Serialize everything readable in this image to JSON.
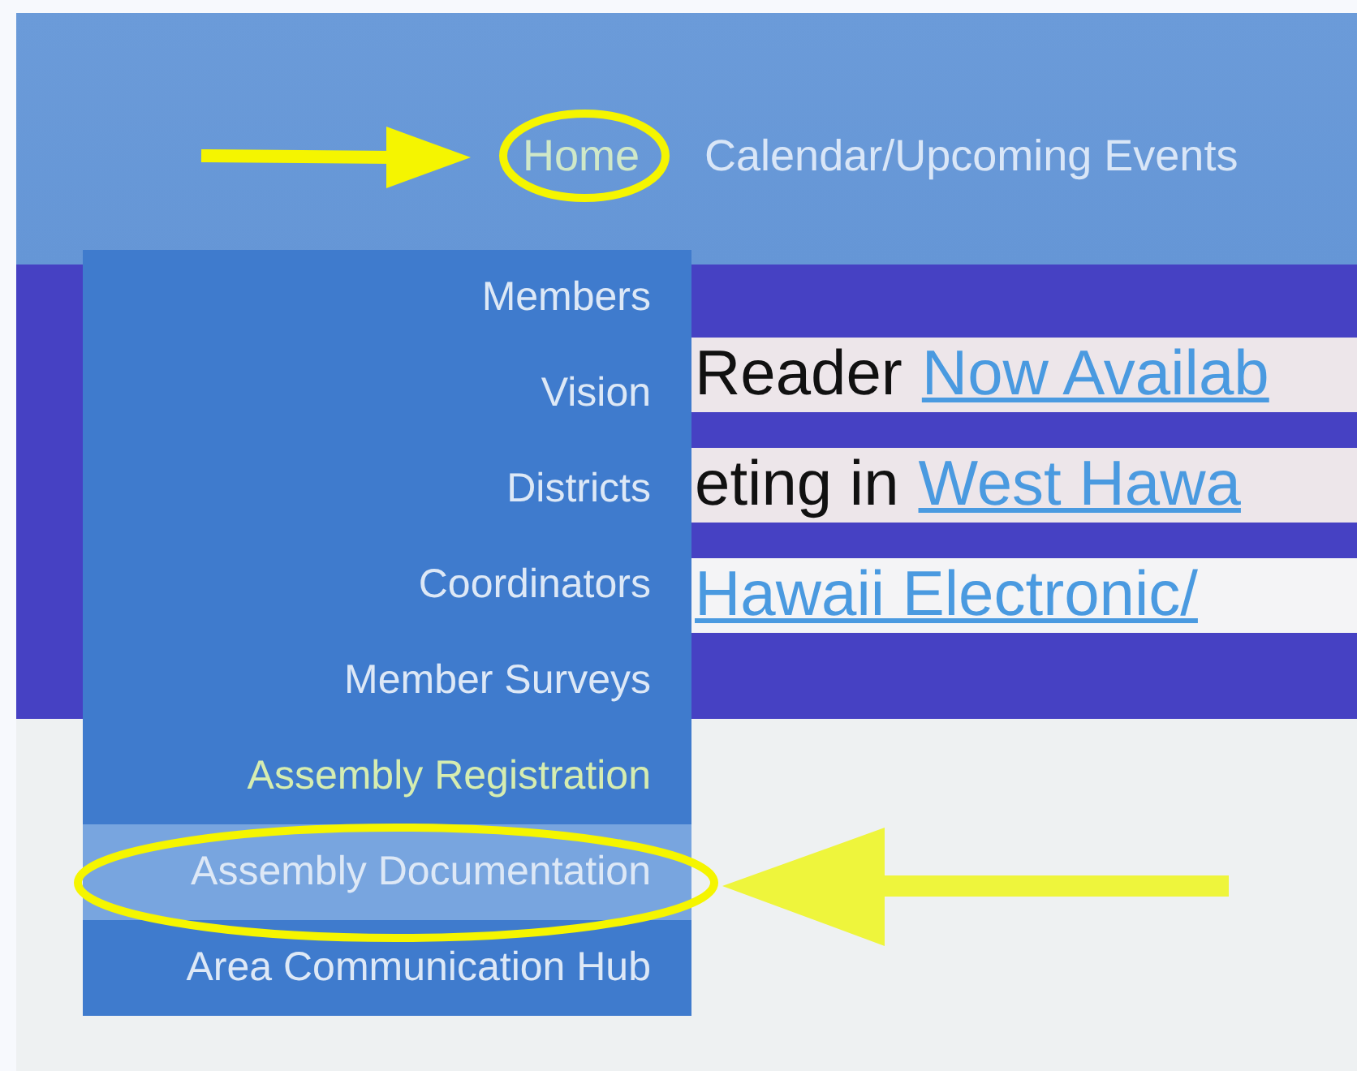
{
  "nav": [
    {
      "label": "Home",
      "selected": true
    },
    {
      "label": "Calendar/Upcoming Events",
      "selected": false
    }
  ],
  "dropdown": {
    "items": [
      {
        "label": "Members",
        "active": false,
        "selected": false
      },
      {
        "label": "Vision",
        "active": false,
        "selected": false
      },
      {
        "label": "Districts",
        "active": false,
        "selected": false
      },
      {
        "label": "Coordinators",
        "active": false,
        "selected": false
      },
      {
        "label": "Member Surveys",
        "active": false,
        "selected": false
      },
      {
        "label": "Assembly Registration",
        "active": true,
        "selected": false
      },
      {
        "label": "Assembly Documentation",
        "active": false,
        "selected": true
      },
      {
        "label": "Area Communication Hub",
        "active": false,
        "selected": false
      }
    ]
  },
  "banner": {
    "lines": [
      {
        "segments": [
          {
            "kind": "text",
            "text": "Reader"
          },
          {
            "kind": "link",
            "text": "Now Availab"
          }
        ]
      },
      {
        "segments": [
          {
            "kind": "text",
            "text": "eting in"
          },
          {
            "kind": "link",
            "text": "West Hawa"
          }
        ]
      },
      {
        "segments": [
          {
            "kind": "link",
            "text": "Hawaii Electronic/"
          }
        ]
      }
    ]
  }
}
